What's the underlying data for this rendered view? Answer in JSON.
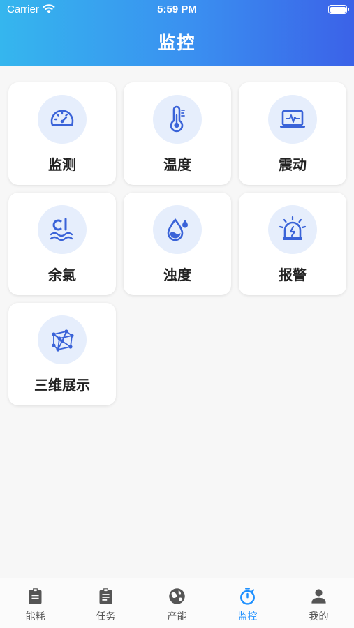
{
  "status_bar": {
    "carrier": "Carrier",
    "time": "5:59 PM"
  },
  "header": {
    "title": "监控"
  },
  "cards": [
    {
      "label": "监测",
      "icon": "gauge-icon"
    },
    {
      "label": "温度",
      "icon": "thermometer-icon"
    },
    {
      "label": "震动",
      "icon": "vibration-monitor-icon"
    },
    {
      "label": "余氯",
      "icon": "chlorine-icon"
    },
    {
      "label": "浊度",
      "icon": "water-drop-icon"
    },
    {
      "label": "报警",
      "icon": "alarm-siren-icon"
    },
    {
      "label": "三维展示",
      "icon": "cube-3d-icon"
    }
  ],
  "tabs": [
    {
      "label": "能耗",
      "icon": "clipboard-icon"
    },
    {
      "label": "任务",
      "icon": "clipboard-list-icon"
    },
    {
      "label": "产能",
      "icon": "globe-icon"
    },
    {
      "label": "监控",
      "icon": "stopwatch-icon",
      "active": true
    },
    {
      "label": "我的",
      "icon": "person-icon"
    }
  ],
  "colors": {
    "accent": "#1e90ff",
    "icon_blue": "#3a63d8",
    "icon_bg": "#e6eefc"
  }
}
